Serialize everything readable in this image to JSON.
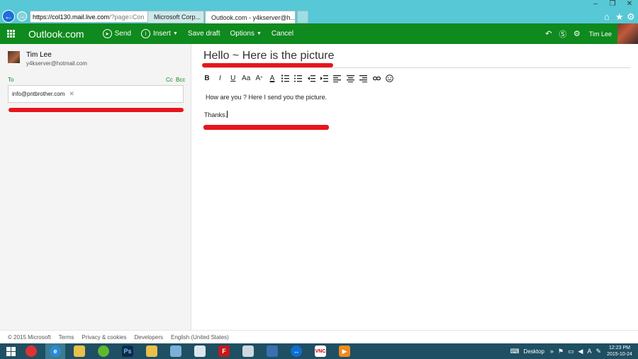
{
  "browser": {
    "url_host": "https://col130.mail.live.com",
    "url_rest": "/?page=Con",
    "tabs": [
      {
        "label": "Microsoft Corp..."
      },
      {
        "label": "Outlook.com - y4kserver@h..."
      }
    ],
    "accent": "#57c8d5"
  },
  "appbar": {
    "brand": "Outlook.com",
    "send_label": "Send",
    "insert_label": "Insert",
    "save_draft_label": "Save draft",
    "options_label": "Options",
    "cancel_label": "Cancel",
    "user_name": "Tim Lee",
    "color": "#0f8a1e"
  },
  "sender": {
    "name": "Tim Lee",
    "email": "y4kserver@hotmail.com"
  },
  "recipients": {
    "to_label": "To",
    "cc_label": "Cc",
    "bcc_label": "Bcc",
    "to": [
      "info@pntbrother.com"
    ]
  },
  "message": {
    "subject": "Hello ~ Here is the picture",
    "body_line1": "How are you ? Here I send you the picture.",
    "body_line2": "Thanks."
  },
  "toolbar": {
    "bold": "B",
    "italic": "I",
    "underline": "U",
    "font_size": "Aa",
    "grow_font": "A",
    "font_color": "A"
  },
  "footer": {
    "copyright": "© 2015 Microsoft",
    "terms": "Terms",
    "privacy": "Privacy & cookies",
    "developers": "Developers",
    "language": "English (United States)"
  },
  "taskbar": {
    "apps": [
      "chrome-icon",
      "ie-icon",
      "file-explorer-icon",
      "dreamweaver-icon",
      "photoshop-icon",
      "folder-icon",
      "scanner-icon",
      "document-icon",
      "filezilla-icon",
      "network-icon",
      "remote-desktop-icon",
      "teamviewer-icon",
      "vnc-icon",
      "media-player-icon"
    ],
    "desktop_label": "Desktop",
    "time": "12:23 PM",
    "date": "2015-10-24",
    "color": "#1f4f63"
  }
}
